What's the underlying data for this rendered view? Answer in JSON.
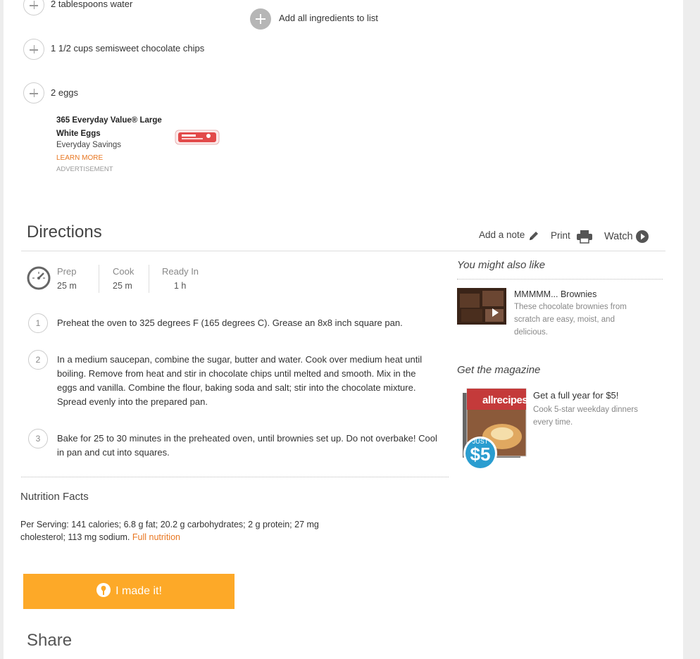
{
  "ingredients": [
    {
      "text": "2 tablespoons water"
    },
    {
      "text": "1 1/2 cups semisweet chocolate chips"
    },
    {
      "text": "2 eggs"
    }
  ],
  "add_all_label": "Add all ingredients to list",
  "ad": {
    "title_line1": "365 Everyday Value® Large",
    "title_line2": "White Eggs",
    "subtitle": "Everyday Savings",
    "learn_more": "LEARN MORE",
    "label": "ADVERTISEMENT"
  },
  "directions": {
    "title": "Directions",
    "add_note": "Add a note",
    "print": "Print",
    "watch": "Watch",
    "times": [
      {
        "label": "Prep",
        "value": "25 m"
      },
      {
        "label": "Cook",
        "value": "25 m"
      },
      {
        "label": "Ready In",
        "value": "1 h"
      }
    ],
    "steps": [
      {
        "num": "1",
        "lines": [
          "Preheat the oven to 325 degrees F (165 degrees C). Grease an 8x8 inch square pan."
        ]
      },
      {
        "num": "2",
        "lines": [
          "In a medium saucepan, combine the sugar, butter and water. Cook over medium heat until",
          "boiling. Remove from heat and stir in chocolate chips until melted and smooth. Mix in the",
          "eggs and vanilla. Combine the flour, baking soda and salt; stir into the chocolate mixture.",
          "Spread evenly into the prepared pan."
        ]
      },
      {
        "num": "3",
        "lines": [
          "Bake for 25 to 30 minutes in the preheated oven, until brownies set up. Do not overbake! Cool",
          "in pan and cut into squares."
        ]
      }
    ]
  },
  "sidebar": {
    "also_like_heading": "You might also like",
    "also_like_title": "MMMMM... Brownies",
    "also_like_desc": [
      "These chocolate brownies from",
      "scratch are easy, moist, and",
      "delicious."
    ],
    "magazine_heading": "Get the magazine",
    "magazine_title": "Get a full year for $5!",
    "magazine_desc": [
      "Cook 5-star weekday dinners",
      "every time."
    ],
    "magazine_cover_brand": "allrecipes",
    "magazine_badge_top": "JUST",
    "magazine_badge_price": "$5"
  },
  "nutrition": {
    "heading": "Nutrition Facts",
    "line1": "Per Serving: 141 calories; 6.8 g fat; 20.2 g carbohydrates; 2 g protein; 27 mg",
    "line2": "cholesterol; 113 mg sodium.",
    "link": "Full nutrition"
  },
  "made_it_label": "I made it!",
  "share_heading": "Share",
  "colors": {
    "accent_orange": "#fda928",
    "link_orange": "#e87722"
  }
}
